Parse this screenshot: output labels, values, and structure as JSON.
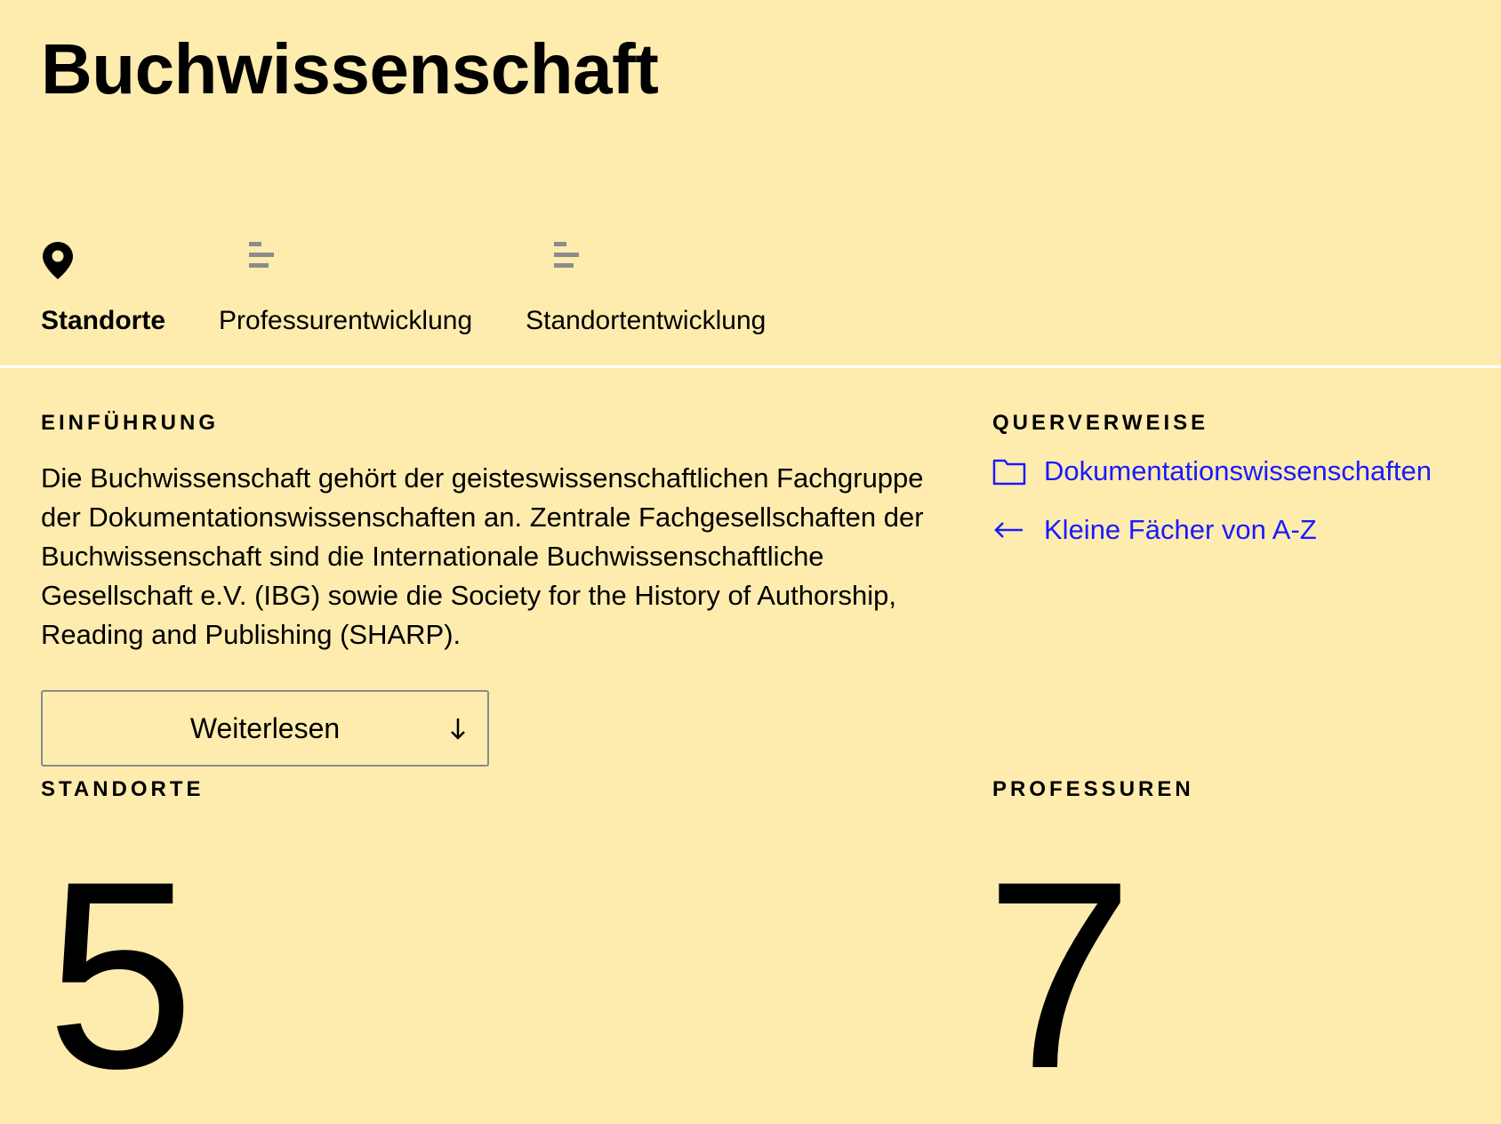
{
  "page": {
    "title": "Buchwissenschaft"
  },
  "tabs": [
    {
      "label": "Standorte",
      "icon": "map-pin-icon",
      "active": true
    },
    {
      "label": "Professurentwicklung",
      "icon": "bar-chart-icon",
      "active": false
    },
    {
      "label": "Standortentwicklung",
      "icon": "bar-chart-icon",
      "active": false
    }
  ],
  "intro": {
    "label": "EINFÜHRUNG",
    "text": "Die Buchwissenschaft gehört der geisteswissenschaftlichen Fachgruppe der Dokumentationswissenschaften an. Zentrale Fachgesellschaften der Buchwissenschaft sind die Internationale Buchwissenschaftliche Gesellschaft e.V. (IBG) sowie die Society for the History of Authorship, Reading and Publishing (SHARP).",
    "read_more_label": "Weiterlesen"
  },
  "cross_references": {
    "label": "QUERVERWEISE",
    "items": [
      {
        "label": "Dokumentationswissenschaften",
        "icon": "folder-icon"
      },
      {
        "label": "Kleine Fächer von A-Z",
        "icon": "arrow-left-icon"
      }
    ]
  },
  "stats": {
    "sites_label": "STANDORTE",
    "sites_value": "5",
    "professorships_label": "PROFESSUREN",
    "professorships_value": "7"
  },
  "colors": {
    "background": "#FEECAF",
    "link": "#1a1aff",
    "divider": "#FFFFFF",
    "button_border": "#8A8A8A",
    "icon_gray": "#8C8C8C"
  }
}
